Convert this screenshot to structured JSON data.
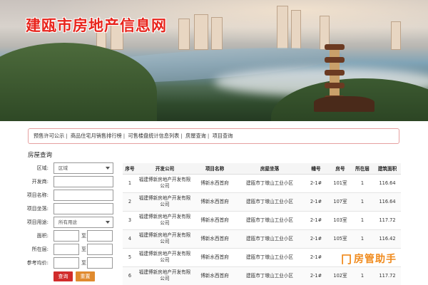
{
  "site": {
    "title": "建瓯市房地产信息网"
  },
  "nav": {
    "items": [
      "预售许可公示",
      "商品住宅月销售排行榜",
      "可售楼盘统计信息列表",
      "房屋查询",
      "项目查询"
    ]
  },
  "section": {
    "title": "房屋查询"
  },
  "form": {
    "district_label": "区域:",
    "district_value": "区域",
    "developer_label": "开发商:",
    "project_label": "项目名称:",
    "location_label": "项目坐落:",
    "usage_label": "项目用途:",
    "usage_value": "所有用途",
    "area_label": "面积:",
    "floor_label": "所在层:",
    "price_label": "参考均价:",
    "to": "至",
    "search_btn": "查询",
    "reset_btn": "重置"
  },
  "table": {
    "headers": [
      "序号",
      "开发公司",
      "项目名称",
      "房屋坐落",
      "幢号",
      "房号",
      "所在层",
      "建筑面积"
    ],
    "rows": [
      [
        "1",
        "福建博新房地产开发有限公司",
        "博新水西首府",
        "建瓯市丁墩山工业小区",
        "2-1#",
        "101室",
        "1",
        "116.64"
      ],
      [
        "2",
        "福建博新房地产开发有限公司",
        "博新水西首府",
        "建瓯市丁墩山工业小区",
        "2-1#",
        "107室",
        "1",
        "116.64"
      ],
      [
        "3",
        "福建博新房地产开发有限公司",
        "博新水西首府",
        "建瓯市丁墩山工业小区",
        "2-1#",
        "103室",
        "1",
        "117.72"
      ],
      [
        "4",
        "福建博新房地产开发有限公司",
        "博新水西首府",
        "建瓯市丁墩山工业小区",
        "2-1#",
        "105室",
        "1",
        "116.42"
      ],
      [
        "5",
        "福建博新房地产开发有限公司",
        "博新水西首府",
        "建瓯市丁墩山工业小区",
        "2-1#",
        "",
        "1",
        ""
      ],
      [
        "6",
        "福建博新房地产开发有限公司",
        "博新水西首府",
        "建瓯市丁墩山工业小区",
        "2-1#",
        "102室",
        "1",
        "117.72"
      ]
    ]
  },
  "watermark": {
    "text": "房管助手"
  }
}
